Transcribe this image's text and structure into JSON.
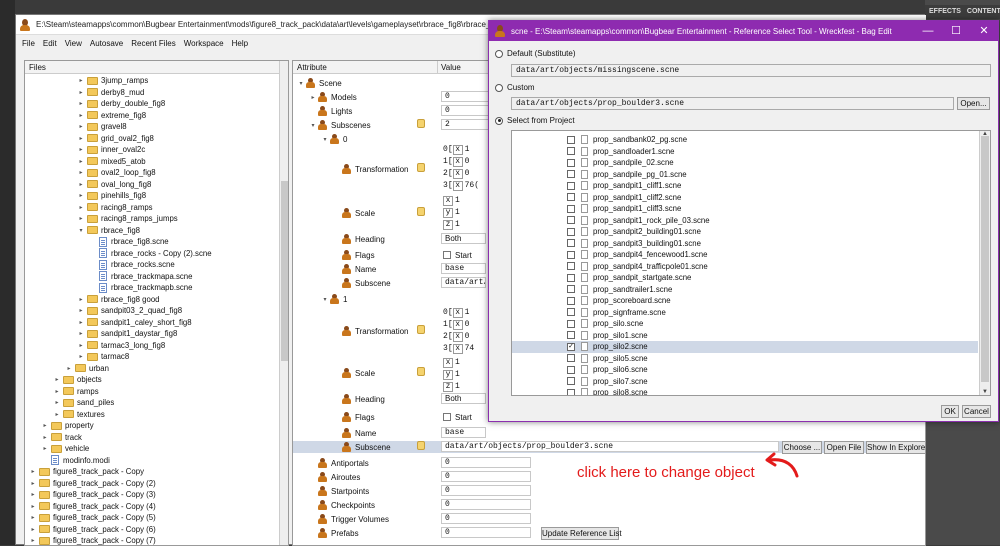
{
  "backdrop": {
    "tab_effects": "EFFECTS",
    "tab_content": "CONTENT"
  },
  "main_window": {
    "title": "E:\\Steam\\steamapps\\common\\Bugbear Entertainment\\mods\\figure8_track_pack\\data\\art\\levels\\gameplayset\\rbrace_fig8\\rbrace_fig8"
  },
  "menu": [
    "File",
    "Edit",
    "View",
    "Autosave",
    "Recent Files",
    "Workspace",
    "Help"
  ],
  "files_panel": {
    "header": "Files",
    "items": [
      {
        "label": "3jump_ramps",
        "type": "folder",
        "depth": 4,
        "tw": "▸"
      },
      {
        "label": "derby8_mud",
        "type": "folder",
        "depth": 4,
        "tw": "▸"
      },
      {
        "label": "derby_double_fig8",
        "type": "folder",
        "depth": 4,
        "tw": "▸"
      },
      {
        "label": "extreme_fig8",
        "type": "folder",
        "depth": 4,
        "tw": "▸"
      },
      {
        "label": "gravel8",
        "type": "folder",
        "depth": 4,
        "tw": "▸"
      },
      {
        "label": "grid_oval2_fig8",
        "type": "folder",
        "depth": 4,
        "tw": "▸"
      },
      {
        "label": "inner_oval2c",
        "type": "folder",
        "depth": 4,
        "tw": "▸"
      },
      {
        "label": "mixed5_atob",
        "type": "folder",
        "depth": 4,
        "tw": "▸"
      },
      {
        "label": "oval2_loop_fig8",
        "type": "folder",
        "depth": 4,
        "tw": "▸"
      },
      {
        "label": "oval_long_fig8",
        "type": "folder",
        "depth": 4,
        "tw": "▸"
      },
      {
        "label": "pinehills_fig8",
        "type": "folder",
        "depth": 4,
        "tw": "▸"
      },
      {
        "label": "racing8_ramps",
        "type": "folder",
        "depth": 4,
        "tw": "▸"
      },
      {
        "label": "racing8_ramps_jumps",
        "type": "folder",
        "depth": 4,
        "tw": "▸"
      },
      {
        "label": "rbrace_fig8",
        "type": "folder",
        "depth": 4,
        "tw": "▾"
      },
      {
        "label": "rbrace_fig8.scne",
        "type": "file",
        "depth": 5,
        "tw": ""
      },
      {
        "label": "rbrace_rocks - Copy (2).scne",
        "type": "file",
        "depth": 5,
        "tw": ""
      },
      {
        "label": "rbrace_rocks.scne",
        "type": "file",
        "depth": 5,
        "tw": ""
      },
      {
        "label": "rbrace_trackmapa.scne",
        "type": "file",
        "depth": 5,
        "tw": ""
      },
      {
        "label": "rbrace_trackmapb.scne",
        "type": "file",
        "depth": 5,
        "tw": ""
      },
      {
        "label": "rbrace_fig8 good",
        "type": "folder",
        "depth": 4,
        "tw": "▸"
      },
      {
        "label": "sandpit03_2_quad_fig8",
        "type": "folder",
        "depth": 4,
        "tw": "▸"
      },
      {
        "label": "sandpit1_caley_short_fig8",
        "type": "folder",
        "depth": 4,
        "tw": "▸"
      },
      {
        "label": "sandpit1_daystar_fig8",
        "type": "folder",
        "depth": 4,
        "tw": "▸"
      },
      {
        "label": "tarmac3_long_fig8",
        "type": "folder",
        "depth": 4,
        "tw": "▸"
      },
      {
        "label": "tarmac8",
        "type": "folder",
        "depth": 4,
        "tw": "▸"
      },
      {
        "label": "urban",
        "type": "folder",
        "depth": 3,
        "tw": "▸"
      },
      {
        "label": "objects",
        "type": "folder",
        "depth": 2,
        "tw": "▸"
      },
      {
        "label": "ramps",
        "type": "folder",
        "depth": 2,
        "tw": "▸"
      },
      {
        "label": "sand_piles",
        "type": "folder",
        "depth": 2,
        "tw": "▸"
      },
      {
        "label": "textures",
        "type": "folder",
        "depth": 2,
        "tw": "▸"
      },
      {
        "label": "property",
        "type": "folder",
        "depth": 1,
        "tw": "▸"
      },
      {
        "label": "track",
        "type": "folder",
        "depth": 1,
        "tw": "▸"
      },
      {
        "label": "vehicle",
        "type": "folder",
        "depth": 1,
        "tw": "▸"
      },
      {
        "label": "modinfo.modi",
        "type": "file",
        "depth": 1,
        "tw": ""
      },
      {
        "label": "figure8_track_pack - Copy",
        "type": "folder",
        "depth": 0,
        "tw": "▸"
      },
      {
        "label": "figure8_track_pack - Copy (2)",
        "type": "folder",
        "depth": 0,
        "tw": "▸"
      },
      {
        "label": "figure8_track_pack - Copy (3)",
        "type": "folder",
        "depth": 0,
        "tw": "▸"
      },
      {
        "label": "figure8_track_pack - Copy (4)",
        "type": "folder",
        "depth": 0,
        "tw": "▸"
      },
      {
        "label": "figure8_track_pack - Copy (5)",
        "type": "folder",
        "depth": 0,
        "tw": "▸"
      },
      {
        "label": "figure8_track_pack - Copy (6)",
        "type": "folder",
        "depth": 0,
        "tw": "▸"
      },
      {
        "label": "figure8_track_pack - Copy (7)",
        "type": "folder",
        "depth": 0,
        "tw": "▸"
      }
    ]
  },
  "attributes": {
    "col_attribute": "Attribute",
    "col_value": "Value",
    "rows": [
      {
        "label": "Scene",
        "indent": 0,
        "tw": "▾",
        "value": ""
      },
      {
        "label": "Models",
        "indent": 1,
        "tw": "▸",
        "value": "0"
      },
      {
        "label": "Lights",
        "indent": 1,
        "tw": "",
        "value": "0"
      },
      {
        "label": "Subscenes",
        "indent": 1,
        "tw": "▾",
        "value": "2"
      },
      {
        "label": "0",
        "indent": 2,
        "tw": "▾",
        "value": ""
      },
      {
        "label": "Transformation",
        "indent": 3,
        "tw": "",
        "value": ""
      },
      {
        "label": "Scale",
        "indent": 3,
        "tw": "",
        "value": ""
      },
      {
        "label": "Heading",
        "indent": 3,
        "tw": "",
        "value": "Both"
      },
      {
        "label": "Flags",
        "indent": 3,
        "tw": "",
        "value": "Start"
      },
      {
        "label": "Name",
        "indent": 3,
        "tw": "",
        "value": "base"
      },
      {
        "label": "Subscene",
        "indent": 3,
        "tw": "",
        "value": "data/art/"
      },
      {
        "label": "1",
        "indent": 2,
        "tw": "▾",
        "value": ""
      },
      {
        "label": "Transformation",
        "indent": 3,
        "tw": "",
        "value": ""
      },
      {
        "label": "Scale",
        "indent": 3,
        "tw": "",
        "value": ""
      },
      {
        "label": "Heading",
        "indent": 3,
        "tw": "",
        "value": "Both"
      },
      {
        "label": "Flags",
        "indent": 3,
        "tw": "",
        "value": "Start"
      },
      {
        "label": "Name",
        "indent": 3,
        "tw": "",
        "value": "base"
      },
      {
        "label": "Subscene",
        "indent": 3,
        "tw": "",
        "value": "data/art/objects/prop_boulder3.scne"
      },
      {
        "label": "Antiportals",
        "indent": 1,
        "tw": "",
        "value": "0"
      },
      {
        "label": "Airoutes",
        "indent": 1,
        "tw": "",
        "value": "0"
      },
      {
        "label": "Startpoints",
        "indent": 1,
        "tw": "",
        "value": "0"
      },
      {
        "label": "Checkpoints",
        "indent": 1,
        "tw": "",
        "value": "0"
      },
      {
        "label": "Trigger Volumes",
        "indent": 1,
        "tw": "",
        "value": "0"
      },
      {
        "label": "Prefabs",
        "indent": 1,
        "tw": "",
        "value": "0"
      }
    ],
    "transform0": [
      {
        "k": "0",
        "v": "[",
        "a": "x",
        "n": "1"
      },
      {
        "k": "1",
        "v": "[",
        "a": "x",
        "n": "0"
      },
      {
        "k": "2",
        "v": "[",
        "a": "x",
        "n": "0"
      },
      {
        "k": "3",
        "v": "[",
        "a": "x",
        "n": "76("
      }
    ],
    "transform1": [
      {
        "k": "0",
        "v": "[",
        "a": "x",
        "n": "1"
      },
      {
        "k": "1",
        "v": "[",
        "a": "x",
        "n": "0"
      },
      {
        "k": "2",
        "v": "[",
        "a": "x",
        "n": "0"
      },
      {
        "k": "3",
        "v": "[",
        "a": "x",
        "n": "74"
      }
    ],
    "scale0": [
      {
        "a": "x",
        "n": "1"
      },
      {
        "a": "y",
        "n": "1"
      },
      {
        "a": "z",
        "n": "1"
      }
    ],
    "scale1": [
      {
        "a": "x",
        "n": "1"
      },
      {
        "a": "y",
        "n": "1"
      },
      {
        "a": "z",
        "n": "1"
      }
    ],
    "buttons": {
      "choose": "Choose ...",
      "open_file": "Open File",
      "show_explorer": "Show In Explorer",
      "update_ref": "Update Reference List"
    }
  },
  "dialog": {
    "title": "scne - E:\\Steam\\steamapps\\common\\Bugbear Entertainment - Reference Select Tool - Wreckfest - Bag Edit",
    "controls": {
      "min": "—",
      "max": "☐",
      "close": "✕"
    },
    "default_label": "Default (Substitute)",
    "default_value": "data/art/objects/missingscene.scne",
    "custom_label": "Custom",
    "custom_value": "data/art/objects/prop_boulder3.scne",
    "open_button": "Open...",
    "project_label": "Select from Project",
    "project_items": [
      "prop_sandbank02_pg.scne",
      "prop_sandloader1.scne",
      "prop_sandpile_02.scne",
      "prop_sandpile_pg_01.scne",
      "prop_sandpit1_cliff1.scne",
      "prop_sandpit1_cliff2.scne",
      "prop_sandpit1_cliff3.scne",
      "prop_sandpit1_rock_pile_03.scne",
      "prop_sandpit2_building01.scne",
      "prop_sandpit3_building01.scne",
      "prop_sandpit4_fencewood1.scne",
      "prop_sandpit4_trafficpole01.scne",
      "prop_sandpit_startgate.scne",
      "prop_sandtrailer1.scne",
      "prop_scoreboard.scne",
      "prop_signframe.scne",
      "prop_silo.scne",
      "prop_silo1.scne",
      "prop_silo2.scne",
      "prop_silo5.scne",
      "prop_silo6.scne",
      "prop_silo7.scne",
      "prop_silo8.scne"
    ],
    "selected_item": "prop_silo2.scne",
    "ok": "OK",
    "cancel": "Cancel"
  },
  "annotation": {
    "text": "click here to change object",
    "color": "#e31b1b"
  },
  "colors": {
    "dialog_title": "#8e2bb0",
    "selection": "#cfd8e6",
    "annotation": "#e31b1b"
  }
}
